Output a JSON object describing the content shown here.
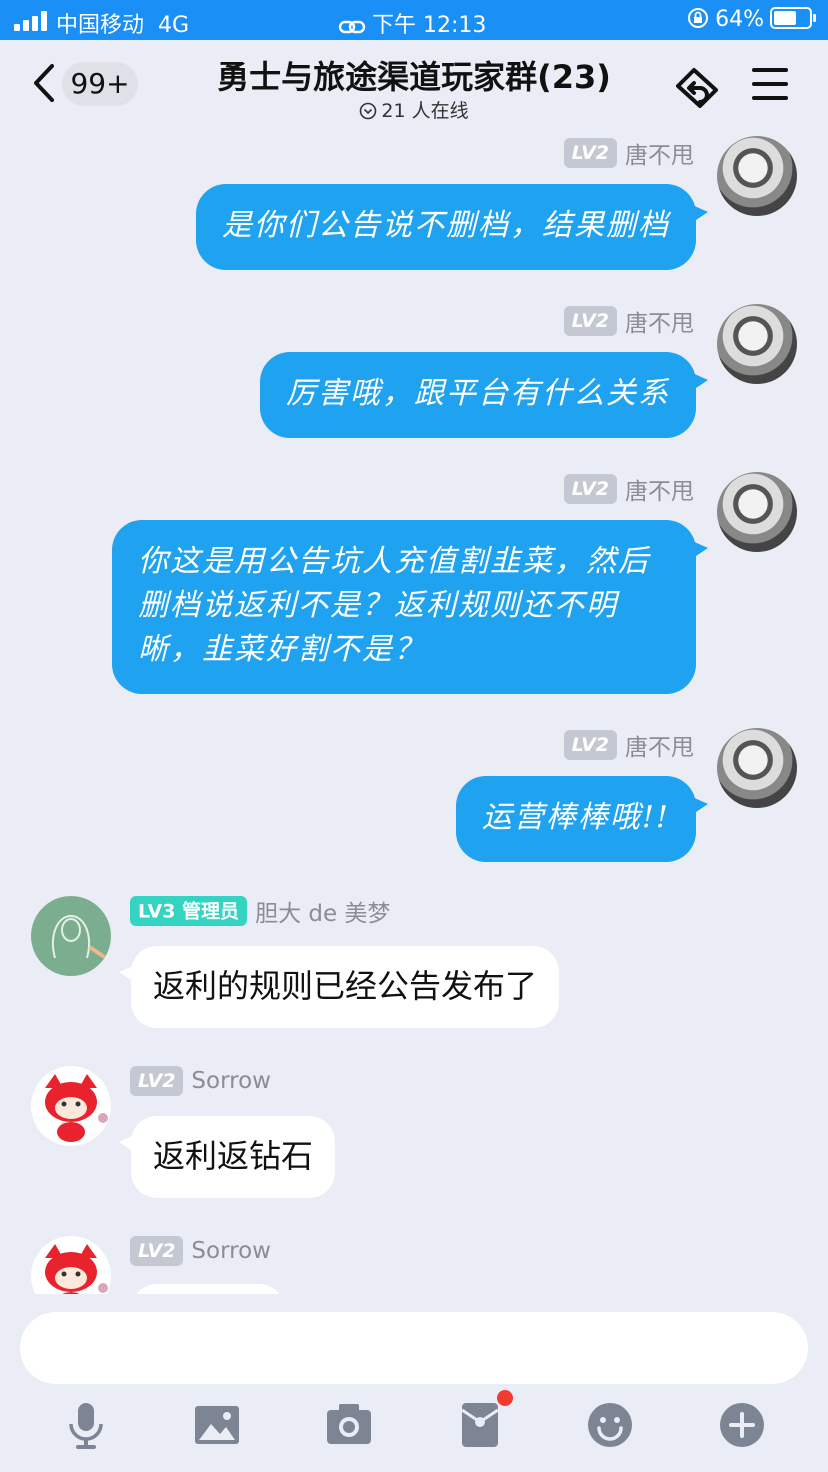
{
  "status_bar": {
    "carrier": "中国移动",
    "network": "4G",
    "time": "下午 12:13",
    "battery": "64%"
  },
  "header": {
    "unread_count": "99+",
    "title": "勇士与旅途渠道玩家群(23)",
    "online": "21 人在线",
    "icons": [
      "back-icon",
      "share-icon",
      "menu-icon"
    ]
  },
  "messages": [
    {
      "sender": "唐不甩",
      "level": "LV2",
      "text": "是你们公告说不删档，结果删档"
    },
    {
      "sender": "唐不甩",
      "level": "LV2",
      "text": "厉害哦，跟平台有什么关系"
    },
    {
      "sender": "唐不甩",
      "level": "LV2",
      "text": "你这是用公告坑人充值割韭菜，然后删档说返利不是？返利规则还不明晰，韭菜好割不是？"
    },
    {
      "sender": "唐不甩",
      "level": "LV2",
      "text": "运营棒棒哦!!"
    },
    {
      "sender": "胆大 de 美梦",
      "level": "LV3",
      "role": "管理员",
      "text": "返利的规则已经公告发布了"
    },
    {
      "sender": "Sorrow",
      "level": "LV2",
      "text": "返利返钻石"
    },
    {
      "sender": "Sorrow",
      "level": "LV2",
      "text": ""
    }
  ],
  "input": {
    "placeholder": ""
  },
  "toolbar": {
    "icons": [
      "microphone-icon",
      "image-icon",
      "camera-icon",
      "red-packet-icon",
      "emoji-icon",
      "plus-icon"
    ],
    "accent": "#7d8594"
  },
  "colors": {
    "status_bar": "#1a8ff5",
    "outgoing_bubble": "#1fa2ef",
    "background": "#eaedf5",
    "admin_badge": "#34d4c2",
    "notification_dot": "#f23a2f"
  }
}
